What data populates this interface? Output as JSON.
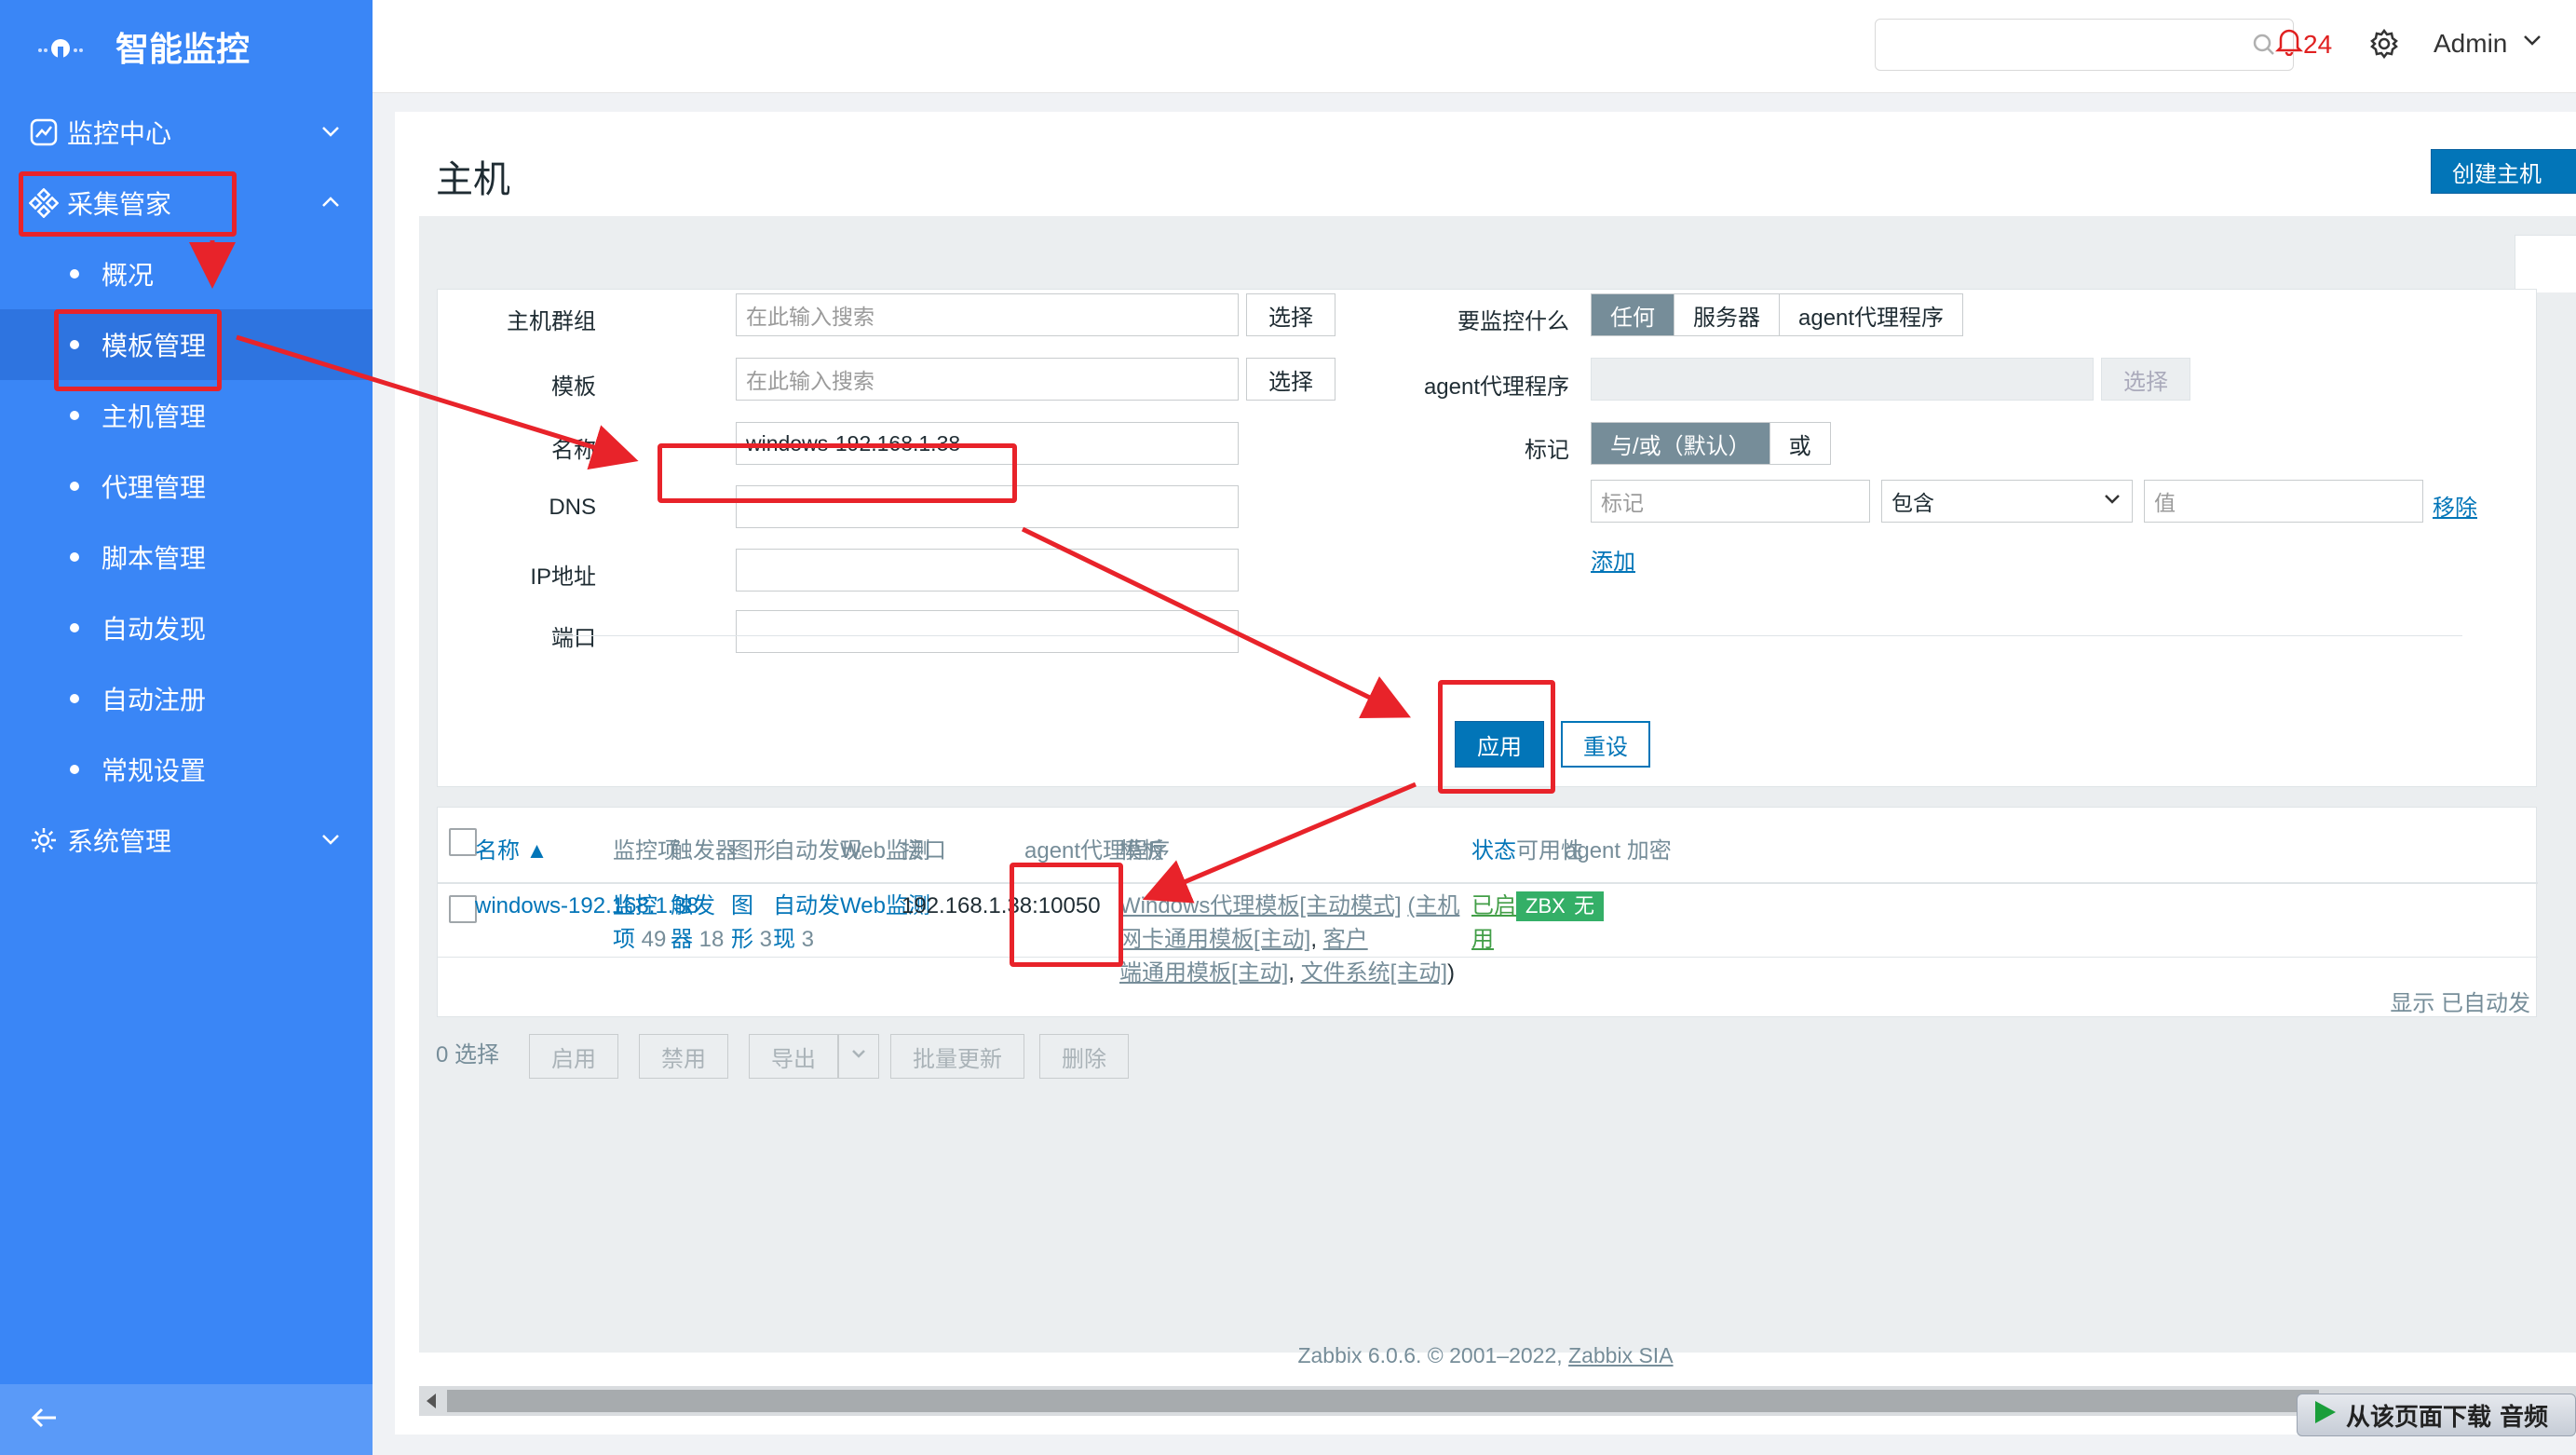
{
  "sidebar": {
    "brand": "智能监控",
    "items": [
      {
        "label": "监控中心"
      },
      {
        "label": "采集管家"
      },
      {
        "label": "系统管理"
      }
    ],
    "subitems": [
      {
        "label": "概况"
      },
      {
        "label": "模板管理"
      },
      {
        "label": "主机管理"
      },
      {
        "label": "代理管理"
      },
      {
        "label": "脚本管理"
      },
      {
        "label": "自动发现"
      },
      {
        "label": "自动注册"
      },
      {
        "label": "常规设置"
      }
    ]
  },
  "topbar": {
    "search_placeholder": "",
    "alert_count": "24",
    "user": "Admin"
  },
  "page": {
    "title": "主机",
    "create_button": "创建主机"
  },
  "filter": {
    "host_group_label": "主机群组",
    "host_group_placeholder": "在此输入搜索",
    "template_label": "模板",
    "template_placeholder": "在此输入搜索",
    "select_label": "选择",
    "name_label": "名称",
    "name_value": "windows-192.168.1.38",
    "dns_label": "DNS",
    "ip_label": "IP地址",
    "port_label": "端口",
    "monitor_label": "要监控什么",
    "monitor_options": [
      "任何",
      "服务器",
      "agent代理程序"
    ],
    "proxy_label": "agent代理程序",
    "tag_label": "标记",
    "tag_options": [
      "与/或（默认）",
      "或"
    ],
    "tag_placeholder": "标记",
    "tag_operator": "包含",
    "tag_value_placeholder": "值",
    "remove_link": "移除",
    "add_link": "添加",
    "apply_button": "应用",
    "reset_button": "重设"
  },
  "table": {
    "headers": [
      "名称 ▲",
      "监控项",
      "触发器",
      "图形",
      "自动发现",
      "Web监测",
      "接口",
      "agent代理程序",
      "模板",
      "状态",
      "可用性",
      "agent 加密"
    ],
    "row": {
      "name": "windows-192.168.1.38",
      "items_l1": "监控",
      "items_l2": "项",
      "items_count": "49",
      "triggers_l1": "触发",
      "triggers_l2": "器",
      "triggers_count": "18",
      "graphs_l1": "图",
      "graphs_l2": "形",
      "graphs_count": "3",
      "discovery_l1": "自动发",
      "discovery_l2": "现",
      "discovery_count": "3",
      "web": "Web监测",
      "interface": "192.168.1.38:10050",
      "template_main": "Windows代理模板[主动模式]",
      "template_p1": "(主机网卡通用模板[主动]",
      "template_p2": "客户",
      "template_p3": "端通用模板[主动]",
      "template_p4": "文件系统[主动]",
      "status_l1": "已启",
      "status_l2": "用",
      "availability": "ZBX",
      "encryption": "无"
    },
    "displayed": "显示 已自动发"
  },
  "bottom": {
    "selected": "0 选择",
    "buttons": [
      "启用",
      "禁用",
      "导出",
      "批量更新",
      "删除"
    ]
  },
  "footer": {
    "text": "Zabbix 6.0.6. © 2001–2022, ",
    "link": "Zabbix SIA"
  },
  "download_bar": "从该页面下载 音频",
  "colors": {
    "sidebar": "#3a86f6",
    "primary": "#0275b8",
    "annotation": "#e8232a",
    "zbx": "#34af67"
  }
}
